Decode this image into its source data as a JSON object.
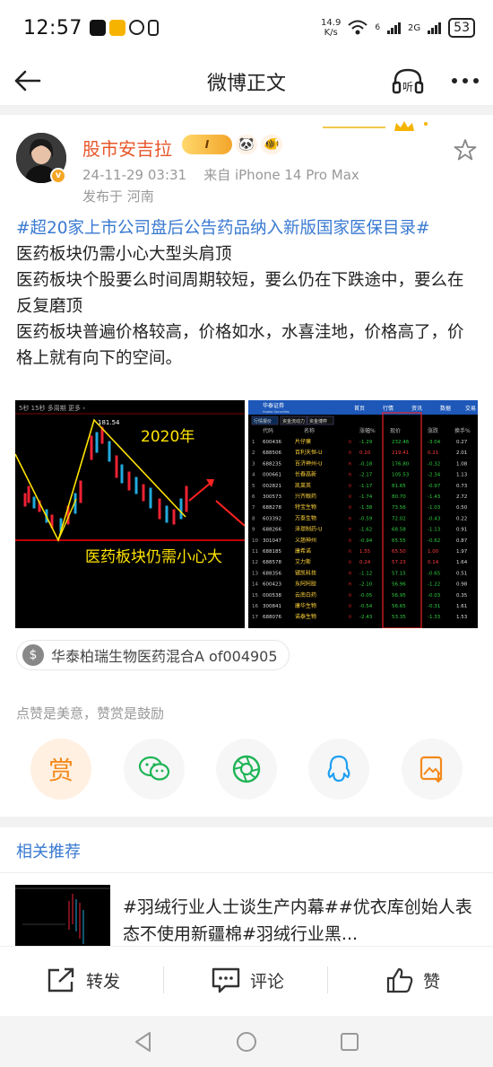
{
  "status_bar": {
    "time": "12:57",
    "net_speed_value": "14.9",
    "net_speed_unit": "K/s",
    "signal_label": "6",
    "net_type": "2G",
    "battery": "53"
  },
  "nav": {
    "title": "微博正文",
    "listen_label": "听"
  },
  "post": {
    "username": "股市安吉拉",
    "vip_badge": "I",
    "vbadge": "v",
    "timestamp": "24-11-29 03:31",
    "source": "来自 iPhone 14 Pro Max",
    "location": "发布于 河南",
    "hashtag": "#超20家上市公司盘后公告药品纳入新版国家医保目录#",
    "lines": [
      "医药板块仍需小心大型头肩顶",
      "医药板块个股要么时间周期较短，要么仍在下跌途中，要么在反复磨顶",
      "医药板块普遍价格较高，价格如水，水喜洼地，价格高了，价格上就有向下的空间。"
    ],
    "image_left": {
      "header": "5秒 15秒 多周期 更多 ›",
      "price_label": "181.54",
      "year": "2020年",
      "caption": "医药板块仍需小心大"
    },
    "image_right": {
      "brand": "华泰证券",
      "brand_en": "Huatai Securities",
      "top_tabs": [
        "首页",
        "行情",
        "资讯",
        "数据",
        "交易"
      ],
      "sub_tabs": [
        "行情报价",
        "资金流动力",
        "资金博弈"
      ],
      "columns": [
        "代码",
        "名称",
        "涨幅%",
        "现价",
        "涨跌",
        "换手%"
      ],
      "rows": [
        [
          "1",
          "600436",
          "片仔癀",
          "-1.29",
          "232.46",
          "-3.04",
          "0.27"
        ],
        [
          "2",
          "688506",
          "百利天恒-U",
          "0.10",
          "219.41",
          "0.21",
          "2.01"
        ],
        [
          "3",
          "688235",
          "百济神州-U",
          "-0.18",
          "176.80",
          "-0.32",
          "1.08"
        ],
        [
          "4",
          "000661",
          "长春高新",
          "-2.17",
          "105.53",
          "-2.34",
          "1.13"
        ],
        [
          "5",
          "002821",
          "凯莱英",
          "-1.17",
          "81.65",
          "-0.97",
          "0.73"
        ],
        [
          "6",
          "300573",
          "兴齐眼药",
          "-1.74",
          "80.70",
          "-1.43",
          "2.72"
        ],
        [
          "7",
          "688278",
          "特宝生物",
          "-1.38",
          "73.56",
          "-1.03",
          "0.50"
        ],
        [
          "8",
          "603392",
          "万泰生物",
          "-0.59",
          "72.02",
          "-0.43",
          "0.22"
        ],
        [
          "9",
          "688266",
          "泽璟制药-U",
          "-1.62",
          "68.58",
          "-1.13",
          "0.91"
        ],
        [
          "10",
          "301047",
          "义翘神州",
          "-0.94",
          "65.55",
          "-0.62",
          "0.87"
        ],
        [
          "11",
          "688185",
          "康希诺",
          "1.55",
          "65.50",
          "1.00",
          "1.97"
        ],
        [
          "12",
          "688578",
          "艾力斯",
          "0.24",
          "57.23",
          "0.14",
          "1.64"
        ],
        [
          "13",
          "688356",
          "键凯科技",
          "-1.12",
          "57.15",
          "-0.65",
          "0.51"
        ],
        [
          "14",
          "600423",
          "东阿阿胶",
          "-2.10",
          "56.96",
          "-1.22",
          "0.98"
        ],
        [
          "15",
          "000538",
          "云南白药",
          "-0.05",
          "56.95",
          "-0.03",
          "0.35"
        ],
        [
          "16",
          "300841",
          "康华生物",
          "-0.54",
          "56.65",
          "-0.31",
          "1.61"
        ],
        [
          "17",
          "688076",
          "诺泰生物",
          "-2.43",
          "53.35",
          "-1.33",
          "1.53"
        ]
      ]
    },
    "fund": "华泰柏瑞生物医药混合A of004905"
  },
  "reward": {
    "hint": "点赞是美意，赞赏是鼓励",
    "shang_label": "赏"
  },
  "related": {
    "title": "相关推荐",
    "text": "#羽绒行业人士谈生产内幕##优衣库创始人表态不使用新疆棉#羽绒行业黑..."
  },
  "actions": {
    "repost": "转发",
    "comment": "评论",
    "like": "赞"
  },
  "colors": {
    "brand_orange": "#e8562a",
    "link_blue": "#3a7ad1",
    "reward_orange": "#f38a1c",
    "up_red": "#ff3b3b",
    "down_green": "#2ecc40"
  }
}
